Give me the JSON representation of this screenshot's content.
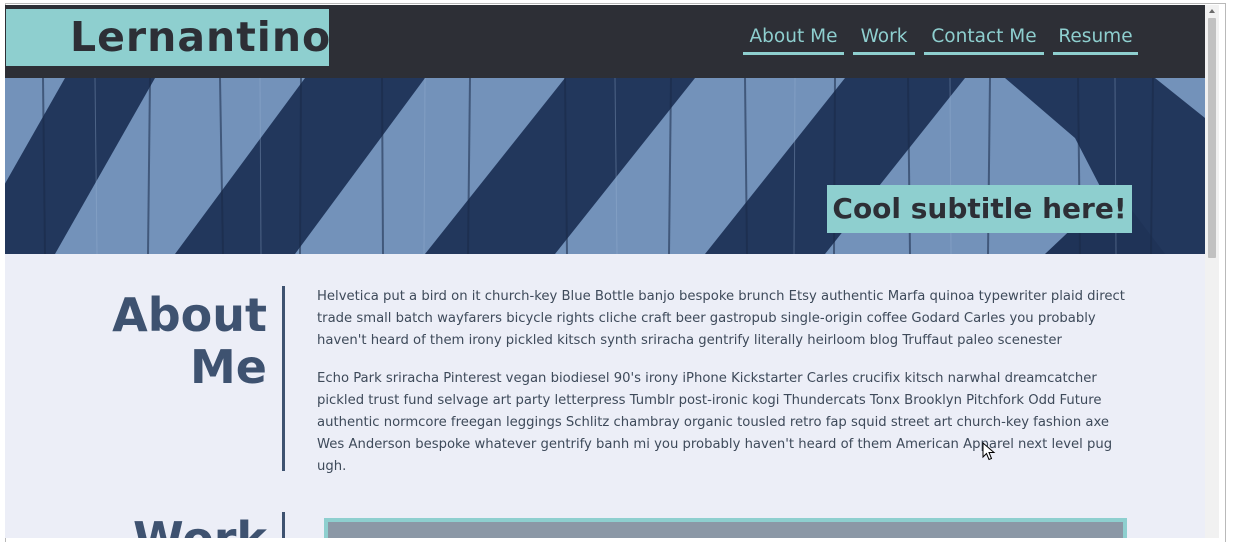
{
  "header": {
    "logo": "Lernantino",
    "nav": [
      {
        "label": "About Me"
      },
      {
        "label": "Work"
      },
      {
        "label": "Contact Me"
      },
      {
        "label": "Resume"
      }
    ]
  },
  "hero": {
    "subtitle": "Cool subtitle here!"
  },
  "about": {
    "title_line1": "About",
    "title_line2": "Me",
    "paragraphs": [
      "Helvetica put a bird on it church-key Blue Bottle banjo bespoke brunch Etsy authentic Marfa quinoa typewriter plaid direct trade small batch wayfarers bicycle rights cliche craft beer gastropub single-origin coffee Godard Carles you probably haven't heard of them irony pickled kitsch synth sriracha gentrify literally heirloom blog Truffaut paleo scenester",
      "Echo Park sriracha Pinterest vegan biodiesel 90's irony iPhone Kickstarter Carles crucifix kitsch narwhal dreamcatcher pickled trust fund selvage art party letterpress Tumblr post-ironic kogi Thundercats Tonx Brooklyn Pitchfork Odd Future authentic normcore freegan leggings Schlitz chambray organic tousled retro fap squid street art church-key fashion axe Wes Anderson bespoke whatever gentrify banh mi you probably haven't heard of them American Apparel next level pug ugh."
    ]
  },
  "work": {
    "title": "Work"
  },
  "colors": {
    "header_bg": "#2d2f36",
    "accent": "#8ecfcf",
    "heading": "#3e5270",
    "page_bg": "#eceef7"
  }
}
